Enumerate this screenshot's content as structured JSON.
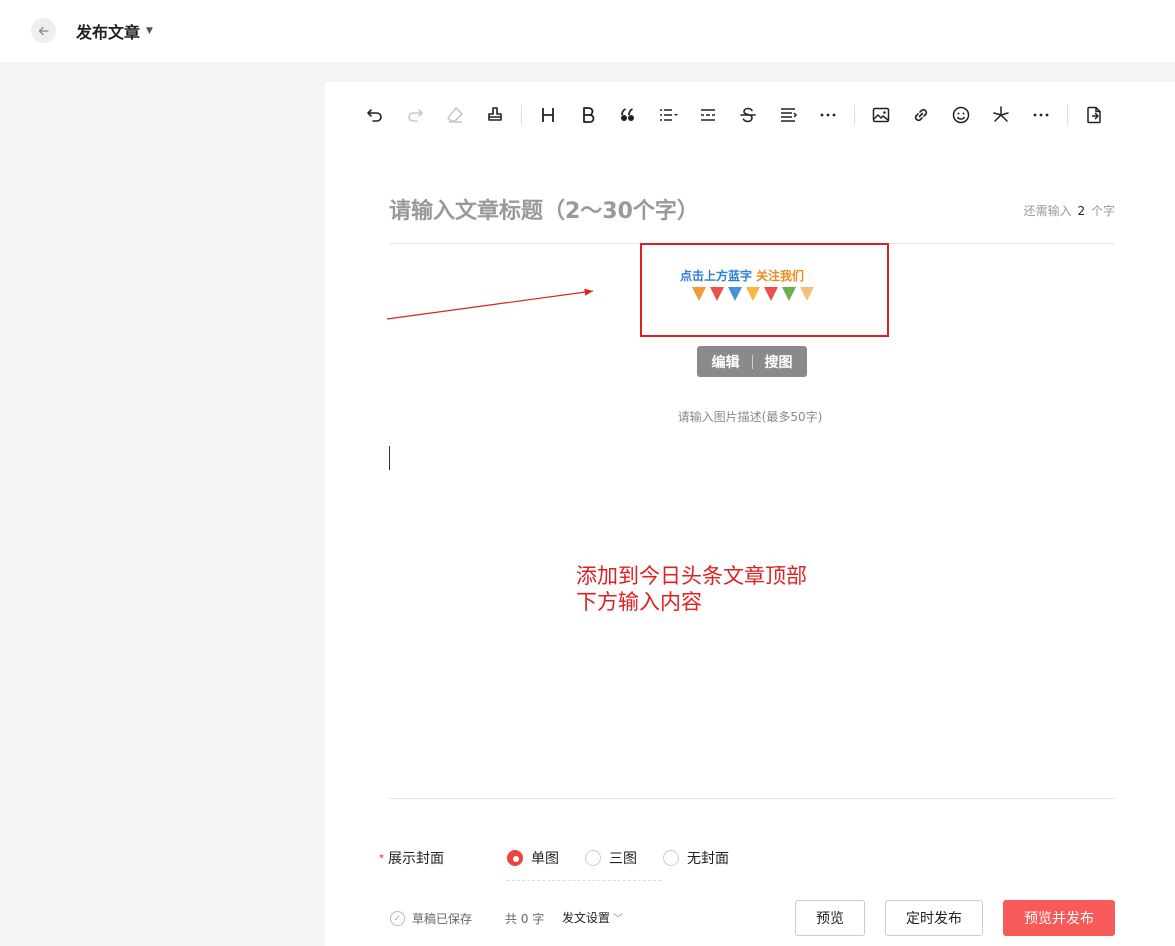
{
  "header": {
    "back_icon": "arrow-left-icon",
    "title": "发布文章"
  },
  "toolbar": {
    "groups": [
      [
        "undo-icon",
        "redo-icon",
        "eraser-icon",
        "format-painter-icon"
      ],
      [
        "heading-icon",
        "bold-icon",
        "quote-icon",
        "list-icon",
        "divider-icon",
        "strikethrough-icon",
        "indent-icon",
        "more-icon"
      ],
      [
        "image-icon",
        "link-icon",
        "emoji-icon",
        "asterisk-icon",
        "more-icon"
      ],
      [
        "import-document-icon"
      ]
    ]
  },
  "article": {
    "title_placeholder": "请输入文章标题（2～30个字）",
    "title_counter_prefix": "还需输入",
    "title_counter_value": "2",
    "title_counter_suffix": "个字"
  },
  "image_block": {
    "banner_blue": "点击上方蓝字",
    "banner_orange": "关注我们",
    "flag_colors": [
      "#f19a3a",
      "#e8524a",
      "#4a90d9",
      "#f5b942",
      "#e8524a",
      "#6ab04c",
      "#f1c27d"
    ],
    "edit_label": "编辑",
    "search_label": "搜图",
    "description_placeholder": "请输入图片描述(最多50字)"
  },
  "annotation": {
    "text": "添加到今日头条文章顶部\n下方输入内容",
    "color": "#e02020"
  },
  "cover": {
    "label": "展示封面",
    "required_mark": "*",
    "options": [
      {
        "label": "单图",
        "checked": true
      },
      {
        "label": "三图",
        "checked": false
      },
      {
        "label": "无封面",
        "checked": false
      }
    ]
  },
  "footer": {
    "saved_label": "草稿已保存",
    "word_count": "共 0 字",
    "settings_label": "发文设置",
    "preview_label": "预览",
    "schedule_label": "定时发布",
    "publish_label": "预览并发布"
  },
  "colors": {
    "accent": "#f85959",
    "radio_checked": "#f04142"
  }
}
